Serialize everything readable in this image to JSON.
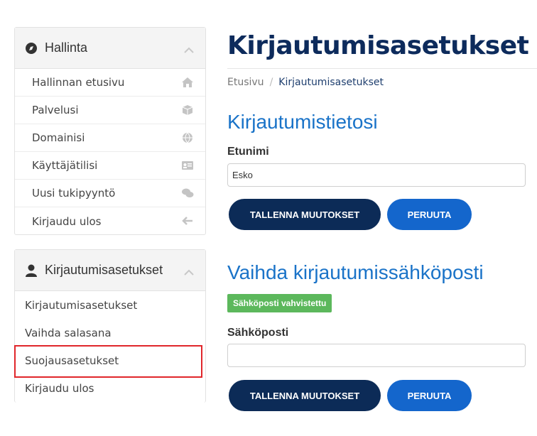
{
  "sidebar": {
    "admin_panel": {
      "title": "Hallinta",
      "items": [
        {
          "label": "Hallinnan etusivu",
          "icon": "home-icon"
        },
        {
          "label": "Palvelusi",
          "icon": "cube-icon"
        },
        {
          "label": "Domainisi",
          "icon": "globe-icon"
        },
        {
          "label": "Käyttäjätilisi",
          "icon": "id-card-icon"
        },
        {
          "label": "Uusi tukipyyntö",
          "icon": "chat-icon"
        },
        {
          "label": "Kirjaudu ulos",
          "icon": "arrow-left-icon"
        }
      ]
    },
    "login_panel": {
      "title": "Kirjautumisasetukset",
      "items": [
        {
          "label": "Kirjautumisasetukset"
        },
        {
          "label": "Vaihda salasana"
        },
        {
          "label": "Suojausasetukset"
        },
        {
          "label": "Kirjaudu ulos"
        }
      ]
    }
  },
  "main": {
    "page_title": "Kirjautumisasetukset",
    "breadcrumb": {
      "home": "Etusivu",
      "separator": "/",
      "current": "Kirjautumisasetukset"
    },
    "login_info": {
      "heading": "Kirjautumistietosi",
      "first_name_label": "Etunimi",
      "first_name_value": "Esko",
      "save_label": "TALLENNA MUUTOKSET",
      "cancel_label": "PERUUTA"
    },
    "email_change": {
      "heading": "Vaihda kirjautumissähköposti",
      "verified_badge": "Sähköposti vahvistettu",
      "email_label": "Sähköposti",
      "email_value": "",
      "save_label": "TALLENNA MUUTOKSET",
      "cancel_label": "PERUUTA"
    }
  },
  "colors": {
    "navy": "#0c2b57",
    "blue": "#1466cc",
    "heading_blue": "#1a73c8",
    "success": "#5cb85c",
    "highlight_red": "#e0262b"
  }
}
